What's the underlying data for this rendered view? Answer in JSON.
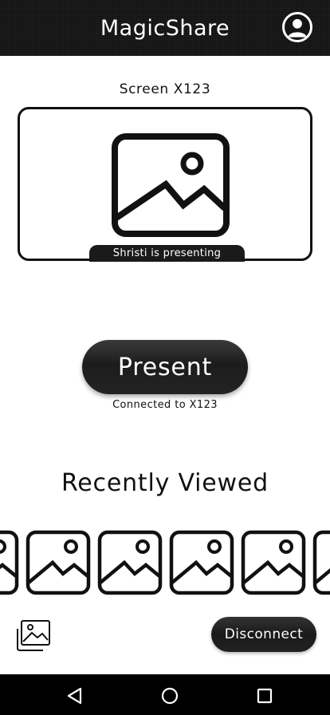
{
  "app": {
    "title": "MagicShare"
  },
  "icons": {
    "profile": "user-circle-icon",
    "preview": "image-icon",
    "gallery": "gallery-icon",
    "back": "nav-back-icon",
    "home": "nav-home-icon",
    "recents": "nav-recents-icon"
  },
  "screen": {
    "label": "Screen X123",
    "presenter_badge": "Shristi is presenting"
  },
  "present": {
    "button_label": "Present",
    "status": "Connected to X123"
  },
  "recent": {
    "heading": "Recently Viewed",
    "thumbnail_count": 6
  },
  "footer": {
    "disconnect_label": "Disconnect"
  },
  "colors": {
    "bar": "#141414",
    "accent": "#1c1c1c",
    "background": "#ffffff"
  }
}
